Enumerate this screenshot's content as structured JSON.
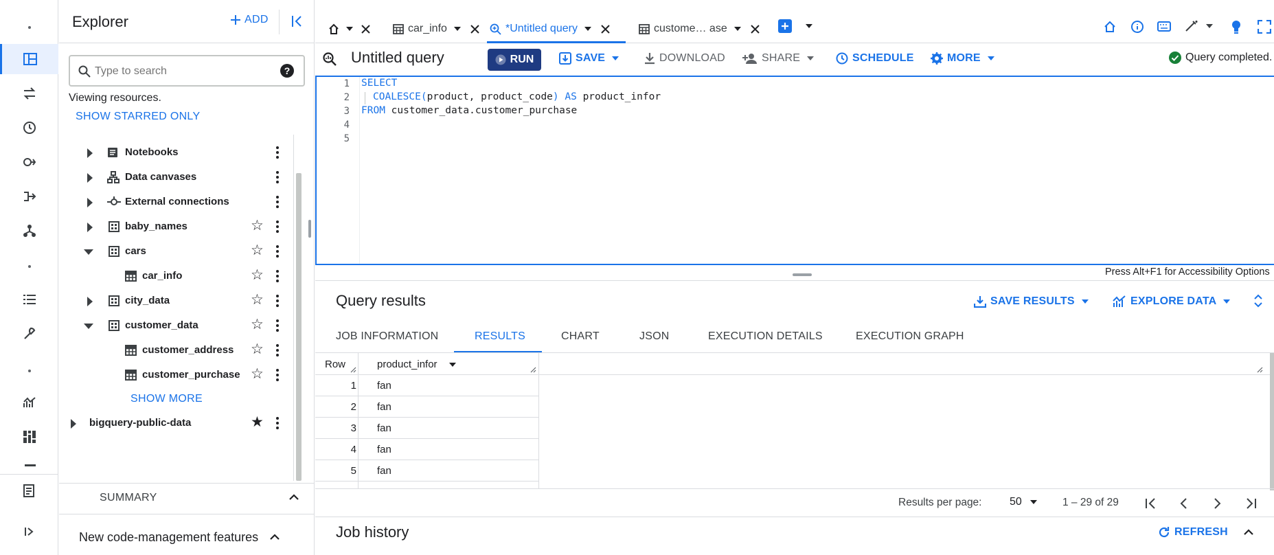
{
  "colors": {
    "accent": "#1a73e8",
    "run_bg": "#1f3b82",
    "success": "#188038",
    "text": "#202124",
    "muted": "#5f6368"
  },
  "rail": {
    "icons": [
      "dot-icon",
      "explorer-icon",
      "transfers-icon",
      "history-icon",
      "analytics-hub-icon",
      "pipelines-icon",
      "dataform-icon",
      "dot-icon",
      "list-icon",
      "wrench-icon",
      "dot-icon",
      "monitoring-icon",
      "dashboard-icon",
      "notes-icon",
      "expand-rail-icon"
    ]
  },
  "explorer": {
    "title": "Explorer",
    "add_label": "ADD",
    "search_placeholder": "Type to search",
    "viewing_text": "Viewing resources.",
    "starred_only": "SHOW STARRED ONLY",
    "items": [
      {
        "label": "Notebooks",
        "icon": "notebook-icon"
      },
      {
        "label": "Data canvases",
        "icon": "data-canvas-icon"
      },
      {
        "label": "External connections",
        "icon": "connection-icon"
      },
      {
        "label": "baby_names",
        "icon": "dataset-icon"
      },
      {
        "label": "cars",
        "icon": "dataset-icon"
      },
      {
        "label": "car_info",
        "icon": "table-icon"
      },
      {
        "label": "city_data",
        "icon": "dataset-icon"
      },
      {
        "label": "customer_data",
        "icon": "dataset-icon"
      },
      {
        "label": "customer_address",
        "icon": "table-icon"
      },
      {
        "label": "customer_purchase",
        "icon": "table-icon"
      }
    ],
    "show_more": "SHOW MORE",
    "public_data": "bigquery-public-data",
    "summary_label": "SUMMARY",
    "code_mgmt": "New code-management features"
  },
  "tabs": [
    {
      "label": "car_info",
      "icon": "table-icon"
    },
    {
      "label": "*Untitled query",
      "icon": "query-icon",
      "active": true
    },
    {
      "label": "custome… ase",
      "icon": "table-icon"
    }
  ],
  "toolbar": {
    "query_title": "Untitled query",
    "run": "RUN",
    "save": "SAVE",
    "download": "DOWNLOAD",
    "share": "SHARE",
    "schedule": "SCHEDULE",
    "more": "MORE",
    "status": "Query completed."
  },
  "editor": {
    "line_numbers": [
      "1",
      "2",
      "3",
      "4",
      "5"
    ],
    "line1": "SELECT",
    "line2_fn": "COALESCE(",
    "line2_args": "product, product_code",
    "line2_close": ")",
    "line2_as": "AS",
    "line2_alias": "product_infor",
    "line3_kw": "FROM",
    "line3_rest": "customer_data.customer_purchase",
    "accessibility_hint": "Press Alt+F1 for Accessibility Options"
  },
  "results": {
    "title": "Query results",
    "save_results": "SAVE RESULTS",
    "explore_data": "EXPLORE DATA",
    "tabs": [
      "JOB INFORMATION",
      "RESULTS",
      "CHART",
      "JSON",
      "EXECUTION DETAILS",
      "EXECUTION GRAPH"
    ],
    "col_row": "Row",
    "col_product": "product_infor",
    "rows": [
      {
        "n": "1",
        "v": "fan"
      },
      {
        "n": "2",
        "v": "fan"
      },
      {
        "n": "3",
        "v": "fan"
      },
      {
        "n": "4",
        "v": "fan"
      },
      {
        "n": "5",
        "v": "fan"
      }
    ],
    "per_page_label": "Results per page:",
    "per_page_value": "50",
    "range": "1 – 29 of 29"
  },
  "job_history": {
    "title": "Job history",
    "refresh": "REFRESH"
  }
}
